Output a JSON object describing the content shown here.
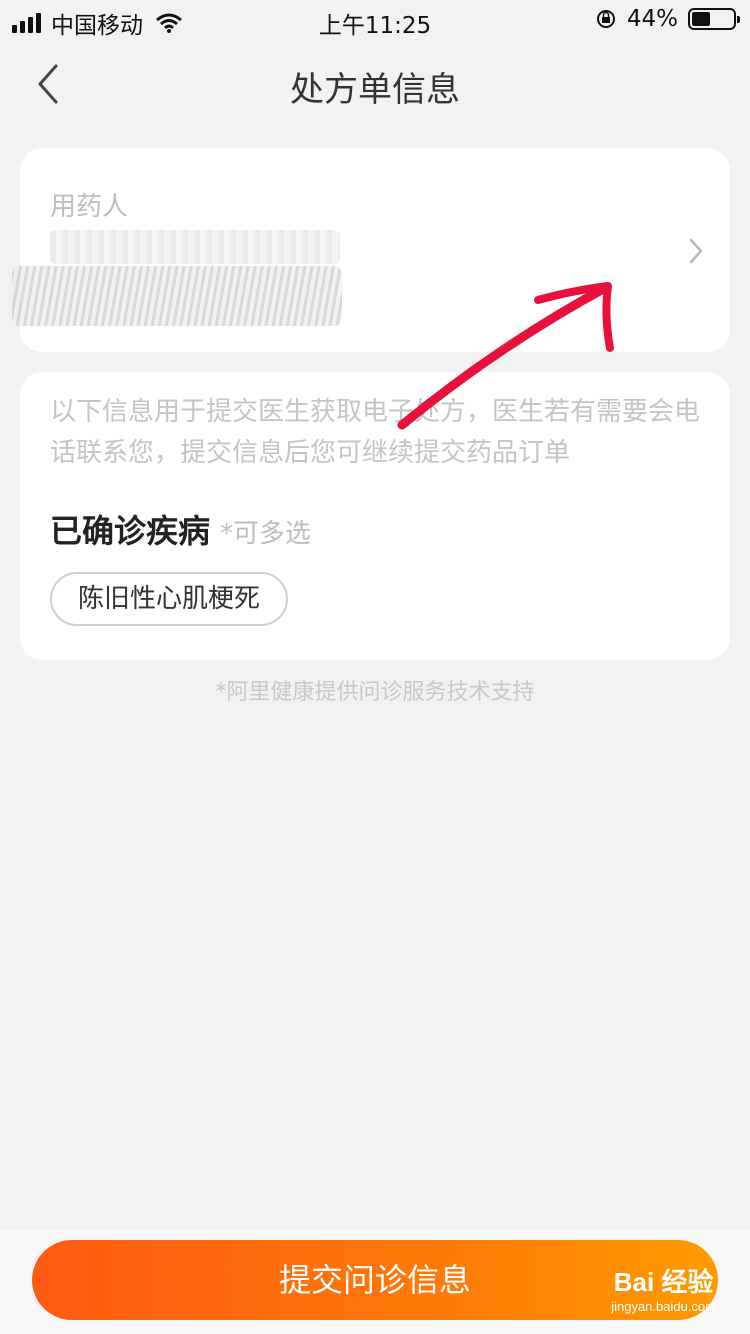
{
  "status_bar": {
    "carrier": "中国移动",
    "time": "上午11:25",
    "battery_percent": "44%",
    "battery_level": 0.44
  },
  "nav": {
    "title": "处方单信息"
  },
  "user_card": {
    "label": "用药人"
  },
  "info_card": {
    "notice": "以下信息用于提交医生获取电子处方，医生若有需要会电话联系您，提交信息后您可继续提交药品订单",
    "section_title": "已确诊疾病",
    "section_hint": "*可多选",
    "tags": [
      "陈旧性心肌梗死"
    ]
  },
  "support_text": "*阿里健康提供问诊服务技术支持",
  "submit_button": "提交问诊信息",
  "watermark": {
    "logo": "Bai 经验",
    "sub": "jingyan.baidu.com"
  },
  "colors": {
    "accent_start": "#ff5a10",
    "accent_end": "#ff9a00",
    "annotation": "#e8103c"
  }
}
